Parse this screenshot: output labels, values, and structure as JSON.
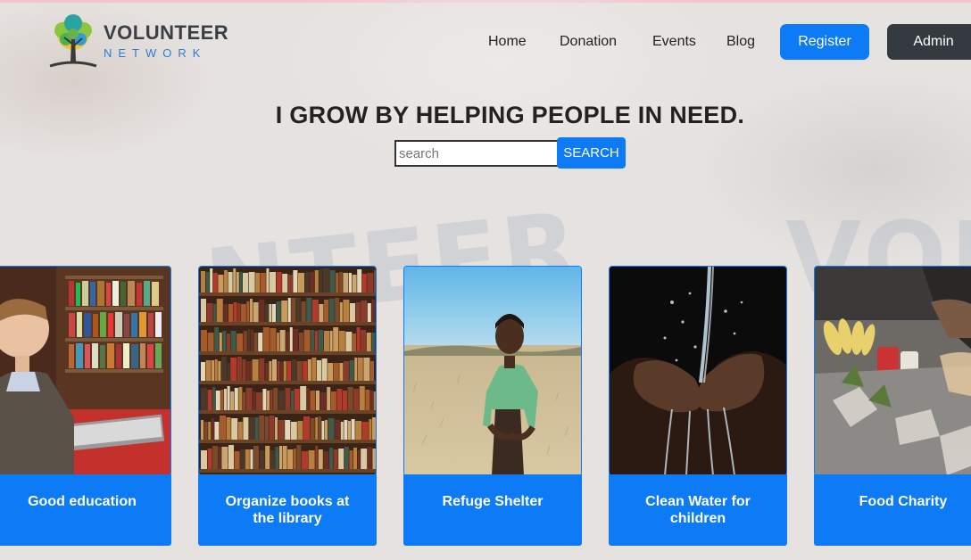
{
  "brand": {
    "name": "VOLUNTEER",
    "sub": "NETWORK"
  },
  "nav": {
    "items": [
      "Home",
      "Donation",
      "Events",
      "Blog"
    ],
    "register_label": "Register",
    "admin_label": "Admin"
  },
  "hero": {
    "headline": "I GROW BY HELPING PEOPLE IN NEED.",
    "search_placeholder": "search",
    "search_button": "SEARCH"
  },
  "background_watermark": [
    "NTEER",
    "VOL"
  ],
  "cards": [
    {
      "title": "Good education",
      "image": "boy-reading-in-library"
    },
    {
      "title": "Organize books at the library",
      "image": "library-bookshelves"
    },
    {
      "title": "Refuge Shelter",
      "image": "child-in-field"
    },
    {
      "title": "Clean Water for children",
      "image": "hands-catching-water"
    },
    {
      "title": "Food Charity",
      "image": "food-distribution"
    }
  ],
  "colors": {
    "primary": "#0d7bf5",
    "dark": "#343a40",
    "background": "#e6e2e0"
  }
}
